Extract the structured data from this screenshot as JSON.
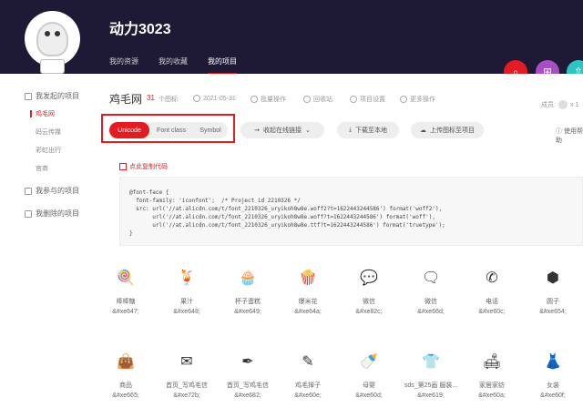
{
  "header": {
    "username": "动力3023",
    "nav": [
      {
        "label": "我的资源",
        "active": false
      },
      {
        "label": "我的收藏",
        "active": false
      },
      {
        "label": "我的项目",
        "active": true
      }
    ]
  },
  "sidebar": {
    "groups": [
      {
        "label": "我发起的项目",
        "items": [
          {
            "label": "鸡毛网",
            "active": true
          },
          {
            "label": "码云传媒",
            "active": false
          },
          {
            "label": "彩虹出行",
            "active": false
          },
          {
            "label": "官商",
            "active": false
          }
        ]
      },
      {
        "label": "我参与的项目",
        "items": []
      },
      {
        "label": "我删除的项目",
        "items": []
      }
    ]
  },
  "project": {
    "title": "鸡毛网",
    "count": "31",
    "count_label": "个图标",
    "date": "2021-05-31",
    "actions": [
      "批量操作",
      "回收站",
      "项目设置",
      "更多操作"
    ],
    "members_label": "成员:",
    "members_count": "x 1"
  },
  "toolbar": {
    "tabs": [
      "Unicode",
      "Font class",
      "Symbol"
    ],
    "active_tab": "Unicode",
    "collapse_label": "收起在线链接",
    "download_label": "下载至本地",
    "upload_label": "上传图标至项目",
    "help_label": "使用帮助"
  },
  "code": {
    "link_label": "点此复制代码",
    "snippet": "@font-face {\n  font-family: 'iconfont';  /* Project id 2210326 */\n  src: url('//at.alicdn.com/t/font_2210326_uryikoh8w8e.woff2?t=1622443244586') format('woff2'),\n       url('//at.alicdn.com/t/font_2210326_uryikoh8w8e.woff?t=1622443244586') format('woff'),\n       url('//at.alicdn.com/t/font_2210326_uryikoh8w8e.ttf?t=1622443244586') format('truetype');\n}"
  },
  "icons": [
    {
      "name": "棒棒糖",
      "code": "&#xe647;",
      "glyph": "lollipop-icon",
      "char": "🍭"
    },
    {
      "name": "果汁",
      "code": "&#xe648;",
      "glyph": "juice-icon",
      "char": "🍹"
    },
    {
      "name": "杯子蛋糕",
      "code": "&#xe649;",
      "glyph": "cupcake-icon",
      "char": "🧁"
    },
    {
      "name": "爆米花",
      "code": "&#xe64a;",
      "glyph": "popcorn-icon",
      "char": "🍿"
    },
    {
      "name": "微信",
      "code": "&#xe82c;",
      "glyph": "wechat-icon",
      "char": "💬"
    },
    {
      "name": "微信",
      "code": "&#xe66d;",
      "glyph": "wechat-alt-icon",
      "char": "🗨"
    },
    {
      "name": "电话",
      "code": "&#xe60c;",
      "glyph": "phone-icon",
      "char": "✆"
    },
    {
      "name": "圆子",
      "code": "&#xe654;",
      "glyph": "hex-nut-icon",
      "char": "⬢"
    },
    {
      "name": "商品",
      "code": "&#xe665;",
      "glyph": "shopping-bag-icon",
      "char": "👜"
    },
    {
      "name": "首页_写鸡毛信",
      "code": "&#xe72b;",
      "glyph": "letter-icon",
      "char": "✉"
    },
    {
      "name": "首页_写鸡毛信",
      "code": "&#xe682;",
      "glyph": "feather-icon",
      "char": "✒"
    },
    {
      "name": "鸡毛掸子",
      "code": "&#xe60e;",
      "glyph": "duster-icon",
      "char": "✎"
    },
    {
      "name": "母婴",
      "code": "&#xe60d;",
      "glyph": "baby-bottle-icon",
      "char": "🍼"
    },
    {
      "name": "sds_第25画 服装...",
      "code": "&#xe619;",
      "glyph": "tshirt-icon",
      "char": "👕"
    },
    {
      "name": "家居家纺",
      "code": "&#xe60a;",
      "glyph": "sofa-icon",
      "char": "🛋"
    },
    {
      "name": "女装",
      "code": "&#xe60f;",
      "glyph": "dress-icon",
      "char": "👗"
    }
  ]
}
